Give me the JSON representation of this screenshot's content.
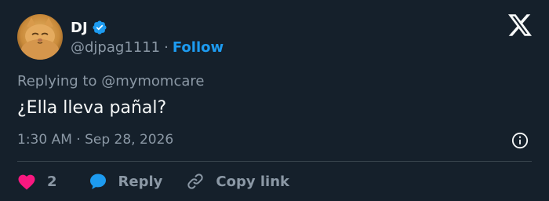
{
  "user": {
    "display_name": "DJ",
    "handle": "@djpag1111",
    "separator": "·",
    "follow_label": "Follow",
    "verified": true
  },
  "tweet": {
    "reply_context": "Replying to @mymomcare",
    "text": "¿Ella lleva pañal?",
    "timestamp": "1:30 AM · Sep 28, 2026"
  },
  "actions": {
    "like_count": "2",
    "reply_label": "Reply",
    "copy_link_label": "Copy link"
  },
  "icons": {
    "logo": "x-logo-icon",
    "verified": "verified-badge-icon",
    "info": "info-icon",
    "like": "heart-icon",
    "reply": "speech-bubble-icon",
    "copy": "link-icon"
  },
  "colors": {
    "background": "#15202b",
    "accent": "#1d9bf0",
    "like": "#f91880",
    "muted": "#8b98a5",
    "text": "#f7f9f9",
    "divider": "#38444d"
  }
}
